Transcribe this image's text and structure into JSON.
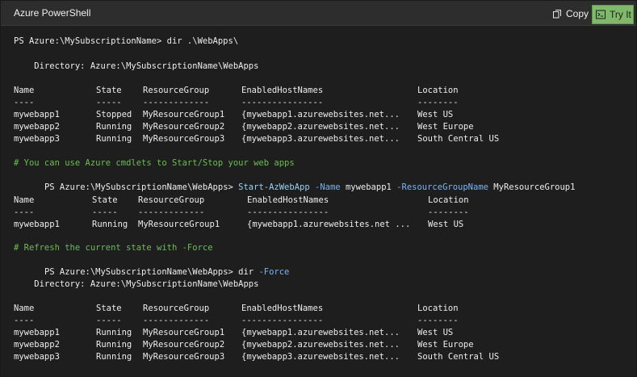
{
  "window": {
    "title": "Azure PowerShell",
    "copy_label": "Copy",
    "try_label": "Try It",
    "try_color": "#7fba6a"
  },
  "console": {
    "line1": "PS Azure:\\MySubscriptionName> dir .\\WebApps\\",
    "directory1": "    Directory: Azure:\\MySubscriptionName\\WebApps",
    "table1": {
      "headers": [
        "Name",
        "State",
        "ResourceGroup",
        "EnabledHostNames",
        "Location"
      ],
      "dashes": [
        "----",
        "-----",
        "-------------",
        "----------------",
        "--------"
      ],
      "rows": [
        [
          "mywebapp1",
          "Stopped",
          "MyResourceGroup1",
          "{mywebapp1.azurewebsites.net...",
          "West US"
        ],
        [
          "mywebapp2",
          "Running",
          "MyResourceGroup2",
          "{mywebapp2.azurewebsites.net...",
          "West Europe"
        ],
        [
          "mywebapp3",
          "Running",
          "MyResourceGroup3",
          "{mywebapp3.azurewebsites.net...",
          "South Central US"
        ]
      ]
    },
    "comment1": "# You can use Azure cmdlets to Start/Stop your web apps",
    "prompt2": "PS Azure:\\MySubscriptionName\\WebApps> ",
    "cmdlet2": "Start-AzWebApp",
    "param2a": "-Name",
    "arg2a": "mywebapp1",
    "param2b": "-ResourceGroupName",
    "arg2b": "MyResourceGroup1",
    "table2": {
      "headers": [
        "Name",
        "State",
        "ResourceGroup",
        "EnabledHostNames",
        "Location"
      ],
      "dashes": [
        "----",
        "-----",
        "-------------",
        "----------------",
        "--------"
      ],
      "rows": [
        [
          "mywebapp1",
          "Running",
          "MyResourceGroup1",
          "{mywebapp1.azurewebsites.net ...",
          "West US"
        ]
      ]
    },
    "comment2": "# Refresh the current state with -Force",
    "prompt3": "PS Azure:\\MySubscriptionName\\WebApps> dir ",
    "param3": "-Force",
    "directory2": "    Directory: Azure:\\MySubscriptionName\\WebApps",
    "table3": {
      "headers": [
        "Name",
        "State",
        "ResourceGroup",
        "EnabledHostNames",
        "Location"
      ],
      "dashes": [
        "----",
        "-----",
        "-------------",
        "----------------",
        "--------"
      ],
      "rows": [
        [
          "mywebapp1",
          "Running",
          "MyResourceGroup1",
          "{mywebapp1.azurewebsites.net...",
          "West US"
        ],
        [
          "mywebapp2",
          "Running",
          "MyResourceGroup2",
          "{mywebapp2.azurewebsites.net...",
          "West Europe"
        ],
        [
          "mywebapp3",
          "Running",
          "MyResourceGroup3",
          "{mywebapp3.azurewebsites.net...",
          "South Central US"
        ]
      ]
    }
  }
}
